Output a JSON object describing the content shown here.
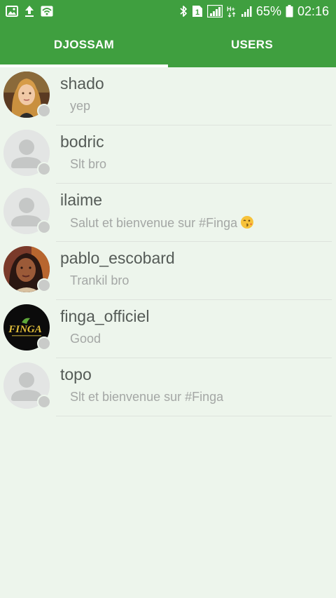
{
  "status_bar": {
    "battery_percent": "65%",
    "time": "02:16",
    "icons_left": [
      "image-icon",
      "upload-icon",
      "wifi-icon"
    ],
    "icons_right": [
      "bluetooth-icon",
      "sim-icon",
      "signal-icon",
      "hplus-icon",
      "signal-bars-icon",
      "battery-icon"
    ]
  },
  "tabs": [
    {
      "label": "DJOSSAM",
      "selected": true
    },
    {
      "label": "USERS",
      "selected": false
    }
  ],
  "colors": {
    "primary": "#3f9f3f",
    "background": "#edf5ec",
    "username": "#555b57",
    "message": "#a4a7a5",
    "presence": "#c9cbc9"
  },
  "chats": [
    {
      "username": "shado",
      "message": "yep",
      "avatar": "photo"
    },
    {
      "username": "bodric",
      "message": "Slt bro",
      "avatar": "placeholder"
    },
    {
      "username": "ilaime",
      "message": "Salut et bienvenue sur #Finga",
      "emoji": "wink-kiss-emoji",
      "avatar": "placeholder"
    },
    {
      "username": "pablo_escobard",
      "message": "Trankil bro",
      "avatar": "photo"
    },
    {
      "username": "finga_officiel",
      "message": "Good",
      "avatar": "logo",
      "logo_text": "FINGA"
    },
    {
      "username": "topo",
      "message": "Slt et bienvenue sur #Finga",
      "avatar": "placeholder"
    }
  ]
}
